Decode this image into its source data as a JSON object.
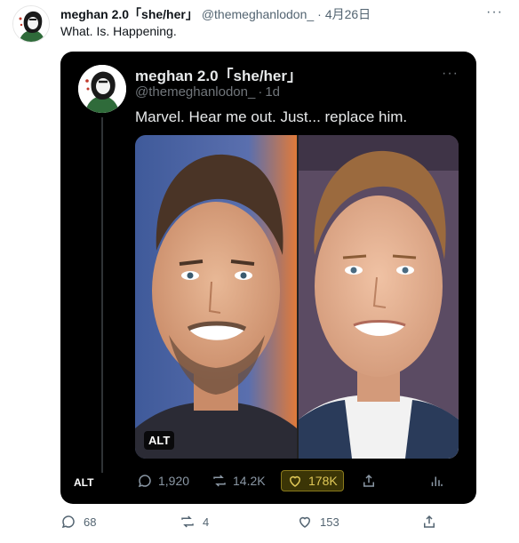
{
  "outer_tweet": {
    "name": "meghan 2.0「she/her」",
    "handle": "@themeghanlodon_",
    "separator": "·",
    "time": "4月26日",
    "text": "What. Is. Happening.",
    "more": "···",
    "stats": {
      "replies": "68",
      "retweets": "4",
      "likes": "153"
    }
  },
  "quoted_tweet": {
    "name": "meghan 2.0「she/her」",
    "handle": "@themeghanlodon_",
    "separator": "·",
    "time": "1d",
    "text": "Marvel. Hear me out. Just... replace him.",
    "more": "···",
    "media_alt_label": "ALT",
    "side_alt_label": "ALT",
    "stats": {
      "replies": "1,920",
      "retweets": "14.2K",
      "likes": "178K"
    }
  },
  "colors": {
    "card_bg": "#000000",
    "muted_dark": "#71767b",
    "muted_light": "#536471",
    "like_highlight": "#e0c858"
  },
  "icons": [
    "avatar-icon",
    "reply-icon",
    "retweet-icon",
    "like-icon",
    "share-icon",
    "stats-icon",
    "more-icon"
  ]
}
